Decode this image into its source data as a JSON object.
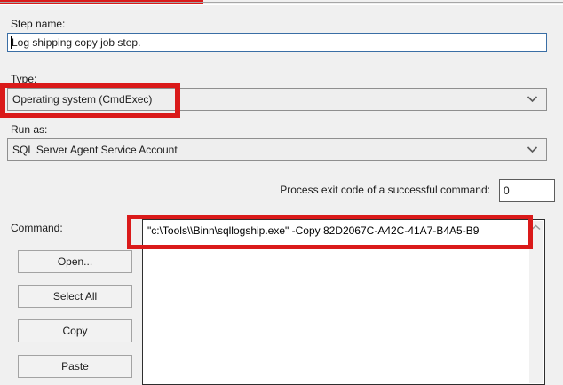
{
  "form": {
    "step_name": {
      "label": "Step name:",
      "value": "Log shipping copy job step."
    },
    "type": {
      "label": "Type:",
      "selected": "Operating system (CmdExec)"
    },
    "run_as": {
      "label": "Run as:",
      "selected": "SQL Server Agent Service Account"
    },
    "exit_code": {
      "label": "Process exit code of a successful command:",
      "value": "0"
    },
    "command": {
      "label": "Command:",
      "value": "\"c:\\Tools\\\\Binn\\sqllogship.exe\" -Copy 82D2067C-A42C-41A7-B4A5-B9"
    },
    "buttons": [
      {
        "label": "Open..."
      },
      {
        "label": "Select All"
      },
      {
        "label": "Copy"
      },
      {
        "label": "Paste"
      }
    ]
  },
  "colors": {
    "highlight_red": "#da1a1a",
    "focus_border_blue": "#3a6ea5",
    "background": "#f0f0f0"
  },
  "icons": {
    "dropdown": "chevron-down",
    "scroll_up": "chevron-up"
  }
}
